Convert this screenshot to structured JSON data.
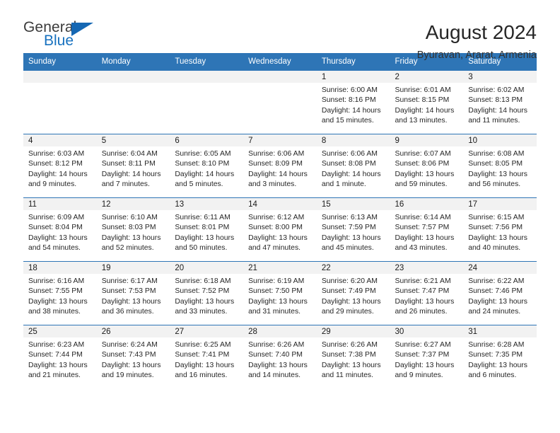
{
  "brand": {
    "name_part1": "General",
    "name_part2": "Blue",
    "accent_color": "#1771bf",
    "triangle_color": "#1567b3"
  },
  "header": {
    "title": "August 2024",
    "subtitle": "Byuravan, Ararat, Armenia"
  },
  "calendar": {
    "header_bg": "#2e75b6",
    "daynum_bg": "#f2f2f2",
    "weekday_headers": [
      "Sunday",
      "Monday",
      "Tuesday",
      "Wednesday",
      "Thursday",
      "Friday",
      "Saturday"
    ],
    "weeks": [
      [
        {
          "day": "",
          "sunrise": "",
          "sunset": "",
          "daylight": ""
        },
        {
          "day": "",
          "sunrise": "",
          "sunset": "",
          "daylight": ""
        },
        {
          "day": "",
          "sunrise": "",
          "sunset": "",
          "daylight": ""
        },
        {
          "day": "",
          "sunrise": "",
          "sunset": "",
          "daylight": ""
        },
        {
          "day": "1",
          "sunrise": "Sunrise: 6:00 AM",
          "sunset": "Sunset: 8:16 PM",
          "daylight": "Daylight: 14 hours and 15 minutes."
        },
        {
          "day": "2",
          "sunrise": "Sunrise: 6:01 AM",
          "sunset": "Sunset: 8:15 PM",
          "daylight": "Daylight: 14 hours and 13 minutes."
        },
        {
          "day": "3",
          "sunrise": "Sunrise: 6:02 AM",
          "sunset": "Sunset: 8:13 PM",
          "daylight": "Daylight: 14 hours and 11 minutes."
        }
      ],
      [
        {
          "day": "4",
          "sunrise": "Sunrise: 6:03 AM",
          "sunset": "Sunset: 8:12 PM",
          "daylight": "Daylight: 14 hours and 9 minutes."
        },
        {
          "day": "5",
          "sunrise": "Sunrise: 6:04 AM",
          "sunset": "Sunset: 8:11 PM",
          "daylight": "Daylight: 14 hours and 7 minutes."
        },
        {
          "day": "6",
          "sunrise": "Sunrise: 6:05 AM",
          "sunset": "Sunset: 8:10 PM",
          "daylight": "Daylight: 14 hours and 5 minutes."
        },
        {
          "day": "7",
          "sunrise": "Sunrise: 6:06 AM",
          "sunset": "Sunset: 8:09 PM",
          "daylight": "Daylight: 14 hours and 3 minutes."
        },
        {
          "day": "8",
          "sunrise": "Sunrise: 6:06 AM",
          "sunset": "Sunset: 8:08 PM",
          "daylight": "Daylight: 14 hours and 1 minute."
        },
        {
          "day": "9",
          "sunrise": "Sunrise: 6:07 AM",
          "sunset": "Sunset: 8:06 PM",
          "daylight": "Daylight: 13 hours and 59 minutes."
        },
        {
          "day": "10",
          "sunrise": "Sunrise: 6:08 AM",
          "sunset": "Sunset: 8:05 PM",
          "daylight": "Daylight: 13 hours and 56 minutes."
        }
      ],
      [
        {
          "day": "11",
          "sunrise": "Sunrise: 6:09 AM",
          "sunset": "Sunset: 8:04 PM",
          "daylight": "Daylight: 13 hours and 54 minutes."
        },
        {
          "day": "12",
          "sunrise": "Sunrise: 6:10 AM",
          "sunset": "Sunset: 8:03 PM",
          "daylight": "Daylight: 13 hours and 52 minutes."
        },
        {
          "day": "13",
          "sunrise": "Sunrise: 6:11 AM",
          "sunset": "Sunset: 8:01 PM",
          "daylight": "Daylight: 13 hours and 50 minutes."
        },
        {
          "day": "14",
          "sunrise": "Sunrise: 6:12 AM",
          "sunset": "Sunset: 8:00 PM",
          "daylight": "Daylight: 13 hours and 47 minutes."
        },
        {
          "day": "15",
          "sunrise": "Sunrise: 6:13 AM",
          "sunset": "Sunset: 7:59 PM",
          "daylight": "Daylight: 13 hours and 45 minutes."
        },
        {
          "day": "16",
          "sunrise": "Sunrise: 6:14 AM",
          "sunset": "Sunset: 7:57 PM",
          "daylight": "Daylight: 13 hours and 43 minutes."
        },
        {
          "day": "17",
          "sunrise": "Sunrise: 6:15 AM",
          "sunset": "Sunset: 7:56 PM",
          "daylight": "Daylight: 13 hours and 40 minutes."
        }
      ],
      [
        {
          "day": "18",
          "sunrise": "Sunrise: 6:16 AM",
          "sunset": "Sunset: 7:55 PM",
          "daylight": "Daylight: 13 hours and 38 minutes."
        },
        {
          "day": "19",
          "sunrise": "Sunrise: 6:17 AM",
          "sunset": "Sunset: 7:53 PM",
          "daylight": "Daylight: 13 hours and 36 minutes."
        },
        {
          "day": "20",
          "sunrise": "Sunrise: 6:18 AM",
          "sunset": "Sunset: 7:52 PM",
          "daylight": "Daylight: 13 hours and 33 minutes."
        },
        {
          "day": "21",
          "sunrise": "Sunrise: 6:19 AM",
          "sunset": "Sunset: 7:50 PM",
          "daylight": "Daylight: 13 hours and 31 minutes."
        },
        {
          "day": "22",
          "sunrise": "Sunrise: 6:20 AM",
          "sunset": "Sunset: 7:49 PM",
          "daylight": "Daylight: 13 hours and 29 minutes."
        },
        {
          "day": "23",
          "sunrise": "Sunrise: 6:21 AM",
          "sunset": "Sunset: 7:47 PM",
          "daylight": "Daylight: 13 hours and 26 minutes."
        },
        {
          "day": "24",
          "sunrise": "Sunrise: 6:22 AM",
          "sunset": "Sunset: 7:46 PM",
          "daylight": "Daylight: 13 hours and 24 minutes."
        }
      ],
      [
        {
          "day": "25",
          "sunrise": "Sunrise: 6:23 AM",
          "sunset": "Sunset: 7:44 PM",
          "daylight": "Daylight: 13 hours and 21 minutes."
        },
        {
          "day": "26",
          "sunrise": "Sunrise: 6:24 AM",
          "sunset": "Sunset: 7:43 PM",
          "daylight": "Daylight: 13 hours and 19 minutes."
        },
        {
          "day": "27",
          "sunrise": "Sunrise: 6:25 AM",
          "sunset": "Sunset: 7:41 PM",
          "daylight": "Daylight: 13 hours and 16 minutes."
        },
        {
          "day": "28",
          "sunrise": "Sunrise: 6:26 AM",
          "sunset": "Sunset: 7:40 PM",
          "daylight": "Daylight: 13 hours and 14 minutes."
        },
        {
          "day": "29",
          "sunrise": "Sunrise: 6:26 AM",
          "sunset": "Sunset: 7:38 PM",
          "daylight": "Daylight: 13 hours and 11 minutes."
        },
        {
          "day": "30",
          "sunrise": "Sunrise: 6:27 AM",
          "sunset": "Sunset: 7:37 PM",
          "daylight": "Daylight: 13 hours and 9 minutes."
        },
        {
          "day": "31",
          "sunrise": "Sunrise: 6:28 AM",
          "sunset": "Sunset: 7:35 PM",
          "daylight": "Daylight: 13 hours and 6 minutes."
        }
      ]
    ]
  }
}
